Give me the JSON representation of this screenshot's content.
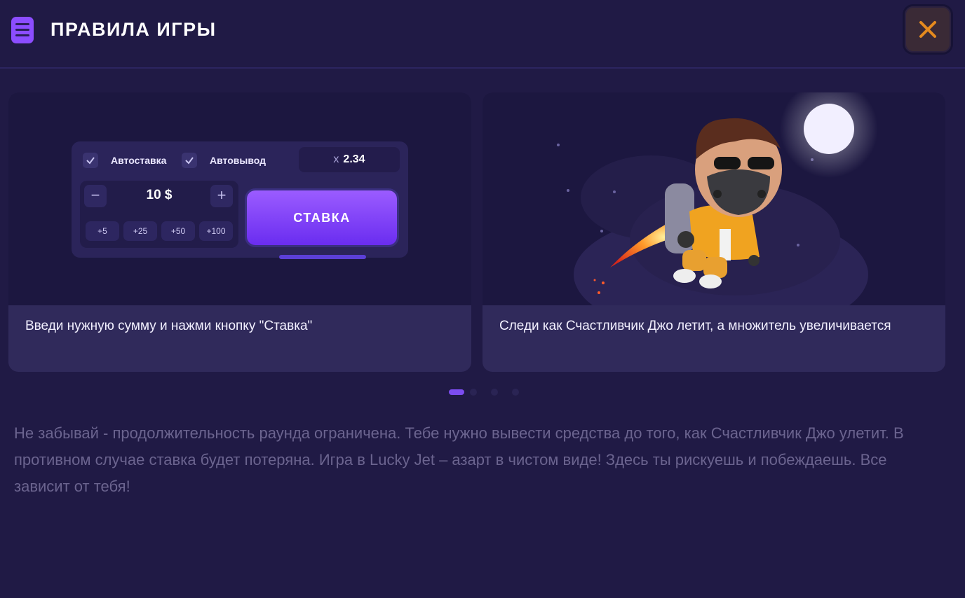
{
  "header": {
    "title": "ПРАВИЛА ИГРЫ",
    "menu_icon": "menu-icon",
    "close_icon": "close-icon"
  },
  "colors": {
    "background": "#201a45",
    "accent": "#8c4dff",
    "close": "#e58a1e",
    "stake": "#7b3cff"
  },
  "cards": [
    {
      "caption": "Введи нужную сумму и нажми кнопку \"Ставка\"",
      "panel": {
        "auto_bet": "Автоставка",
        "auto_cashout": "Автовывод",
        "multiplier_prefix": "x",
        "multiplier": "2.34",
        "amount": "10 $",
        "minus": "−",
        "plus": "+",
        "quick": [
          "+5",
          "+25",
          "+50",
          "+100"
        ],
        "stake_button": "СТАВКА"
      }
    },
    {
      "caption": "Следи как Счастливчик Джо летит, а множитель увеличивается",
      "illustration": "jetpack-character-moon"
    }
  ],
  "pagination": {
    "count": 4,
    "active": 0
  },
  "note": "Не забывай - продолжительность раунда ограничена. Тебе нужно вывести средства до того, как Счастливчик Джо улетит. В противном случае ставка будет потеряна. Игра в Lucky Jet – азарт в чистом виде! Здесь ты рискуешь и побеждаешь. Все зависит от тебя!"
}
